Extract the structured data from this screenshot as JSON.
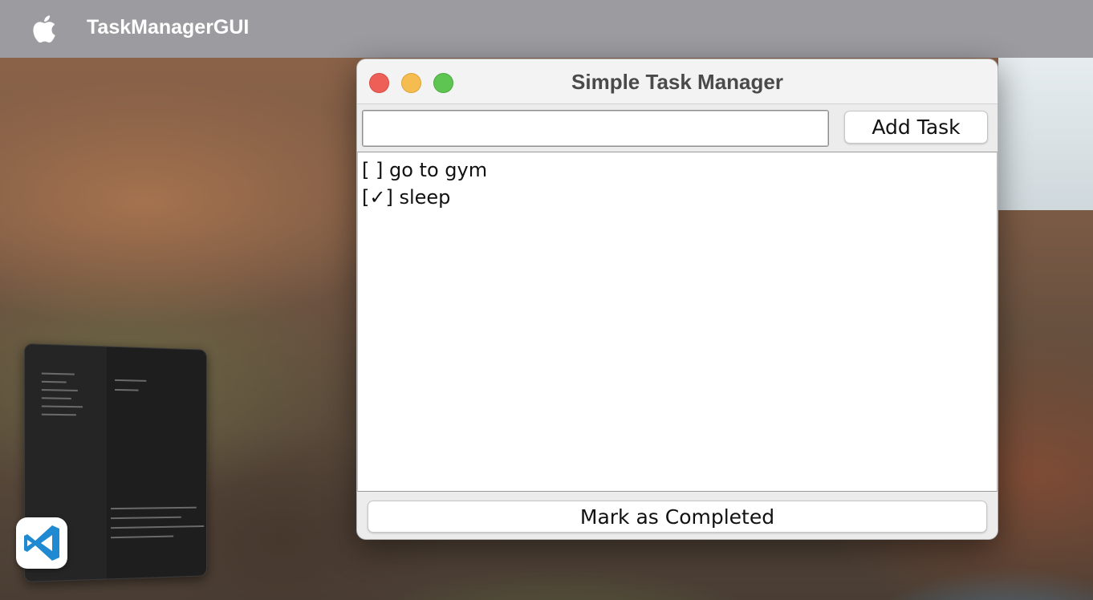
{
  "menubar": {
    "app_name": "TaskManagerGUI",
    "apple_icon": "apple-logo-icon"
  },
  "window": {
    "title": "Simple Task Manager",
    "controls": [
      "close",
      "minimize",
      "zoom"
    ]
  },
  "input": {
    "value": "",
    "placeholder": ""
  },
  "buttons": {
    "add_task": "Add Task",
    "mark_completed": "Mark as Completed"
  },
  "tasks": [
    {
      "label": "[ ] go to gym",
      "completed": false
    },
    {
      "label": "[✓] sleep",
      "completed": true
    }
  ],
  "dock": {
    "app_icon": "vscode-icon"
  },
  "colors": {
    "close": "#ee5f57",
    "minimize": "#f5bd4f",
    "zoom": "#5fc552",
    "vscode_blue": "#1f8ad2"
  }
}
